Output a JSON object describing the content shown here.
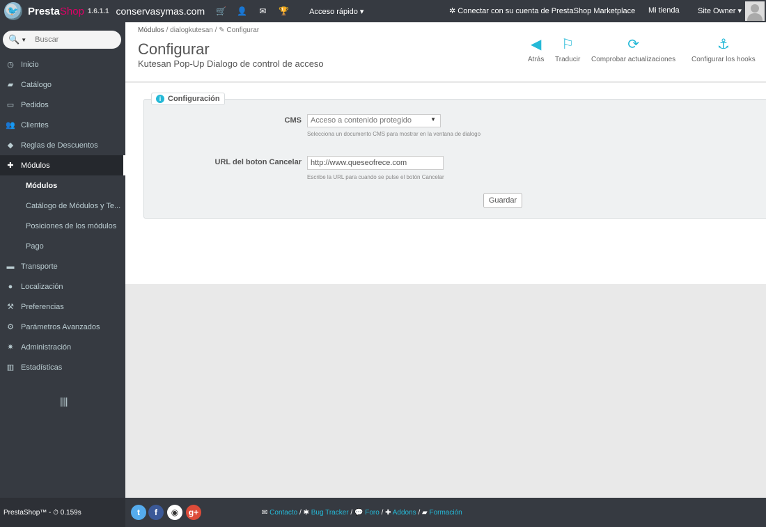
{
  "topbar": {
    "brand_presta": "Presta",
    "brand_shop": "Shop",
    "version": "1.6.1.1",
    "shop_name": "conservasymas.com",
    "quick_access": "Acceso rápido ▾",
    "connect": "Conectar con su cuenta de PrestaShop Marketplace",
    "my_store": "Mi tienda",
    "owner": "Site Owner ▾",
    "icons": [
      "cart-icon",
      "user-icon",
      "envelope-icon",
      "trophy-icon"
    ]
  },
  "sidebar": {
    "search_placeholder": "Buscar",
    "items": [
      {
        "label": "Inicio",
        "icon": "tachometer-icon"
      },
      {
        "label": "Catálogo",
        "icon": "book-icon"
      },
      {
        "label": "Pedidos",
        "icon": "credit-card-icon"
      },
      {
        "label": "Clientes",
        "icon": "users-icon"
      },
      {
        "label": "Reglas de Descuentos",
        "icon": "tag-icon"
      },
      {
        "label": "Módulos",
        "icon": "puzzle-icon"
      },
      {
        "label": "Módulos"
      },
      {
        "label": "Catálogo de Módulos y Te..."
      },
      {
        "label": "Posiciones de los módulos"
      },
      {
        "label": "Pago"
      },
      {
        "label": "Transporte",
        "icon": "truck-icon"
      },
      {
        "label": "Localización",
        "icon": "globe-icon"
      },
      {
        "label": "Preferencias",
        "icon": "wrench-icon"
      },
      {
        "label": "Parámetros Avanzados",
        "icon": "cogs-icon"
      },
      {
        "label": "Administración",
        "icon": "cog-icon"
      },
      {
        "label": "Estadísticas",
        "icon": "bar-chart-icon"
      }
    ]
  },
  "header": {
    "breadcrumb": [
      "Módulos",
      "dialogkutesan",
      "Configurar"
    ],
    "title": "Configurar",
    "subtitle": "Kutesan Pop-Up Dialogo de control de acceso",
    "toolbar": [
      {
        "label": "Atrás",
        "icon": "arrow-circle-left-icon"
      },
      {
        "label": "Traducir",
        "icon": "flag-icon"
      },
      {
        "label": "Comprobar actualizaciones",
        "icon": "refresh-icon"
      },
      {
        "label": "Configurar los hooks",
        "icon": "anchor-icon"
      }
    ]
  },
  "panel": {
    "heading": "Configuración",
    "cms_label": "CMS",
    "cms_value": "Acceso a contenido protegido",
    "cms_help": "Selecciona un documento CMS para mostrar en la ventana de dialogo",
    "url_label": "URL del boton Cancelar",
    "url_value": "http://www.queseofrece.com",
    "url_help": "Escribe la URL para cuando se pulse el botón Cancelar",
    "save_label": "Guardar"
  },
  "footer": {
    "left": "PrestaShop™ - ⏱ 0.159s",
    "links": [
      "Contacto",
      "Bug Tracker",
      "Foro",
      "Addons",
      "Formación"
    ],
    "social": [
      "twitter-icon",
      "facebook-icon",
      "github-icon",
      "google-plus-icon"
    ]
  },
  "colors": {
    "sidebar_bg": "#363a41",
    "accent": "#25b9d7",
    "brand_pink": "#df0067"
  }
}
